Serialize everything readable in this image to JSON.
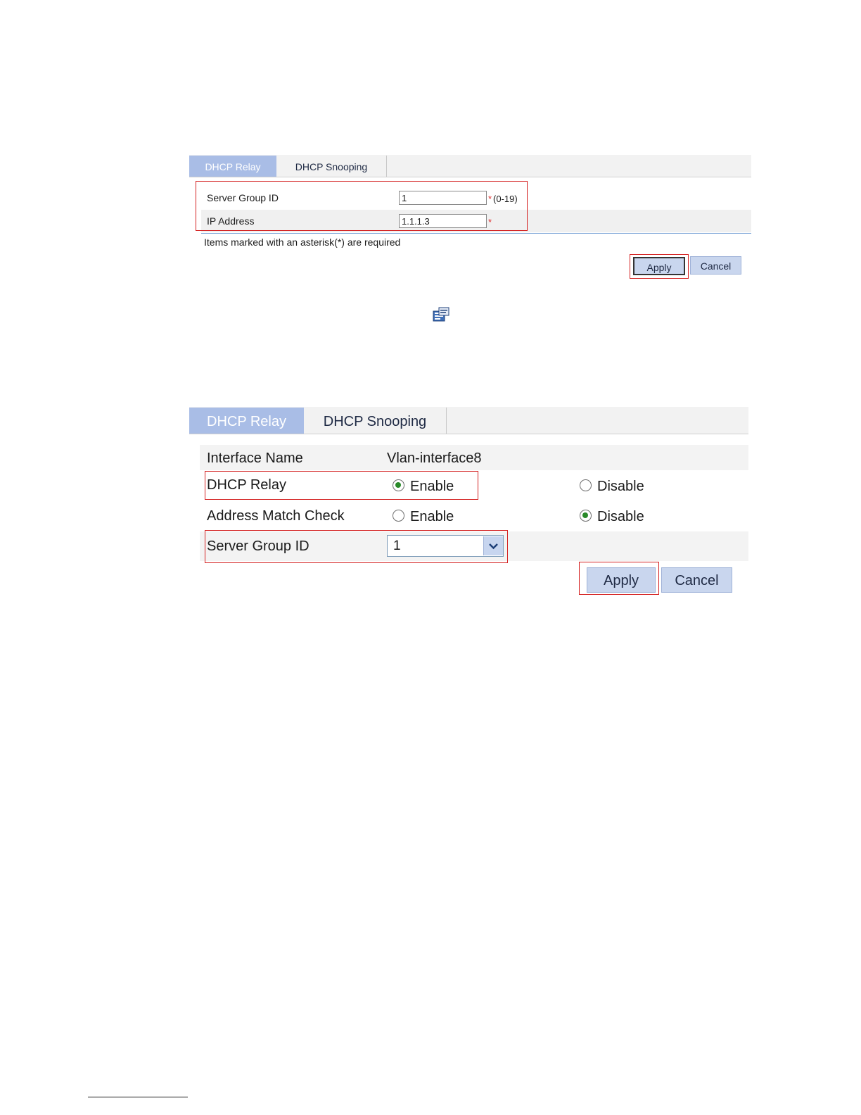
{
  "panel1": {
    "tabs": [
      "DHCP Relay",
      "DHCP Snooping"
    ],
    "fields": [
      {
        "label": "Server Group ID",
        "value": "1",
        "required": "*",
        "hint": "(0-19)"
      },
      {
        "label": "IP Address",
        "value": "1.1.1.3",
        "required": "*"
      }
    ],
    "required_note": "Items marked with an asterisk(*) are required",
    "buttons": {
      "apply": "Apply",
      "cancel": "Cancel"
    }
  },
  "icon": {
    "name": "config-icon"
  },
  "panel2": {
    "tabs": [
      "DHCP Relay",
      "DHCP Snooping"
    ],
    "interface_label": "Interface Name",
    "interface_value": "Vlan-interface8",
    "dhcp_relay": {
      "label": "DHCP Relay",
      "enable": "Enable",
      "disable": "Disable",
      "selected": "Enable"
    },
    "address_match": {
      "label": "Address Match Check",
      "enable": "Enable",
      "disable": "Disable",
      "selected": "Disable"
    },
    "server_group": {
      "label": "Server Group ID",
      "value": "1"
    },
    "buttons": {
      "apply": "Apply",
      "cancel": "Cancel"
    }
  },
  "colors": {
    "highlight": "#d42020",
    "tab_active": "#a9bde6",
    "button": "#c9d6ee",
    "radio_dot": "#2a8a2a"
  }
}
